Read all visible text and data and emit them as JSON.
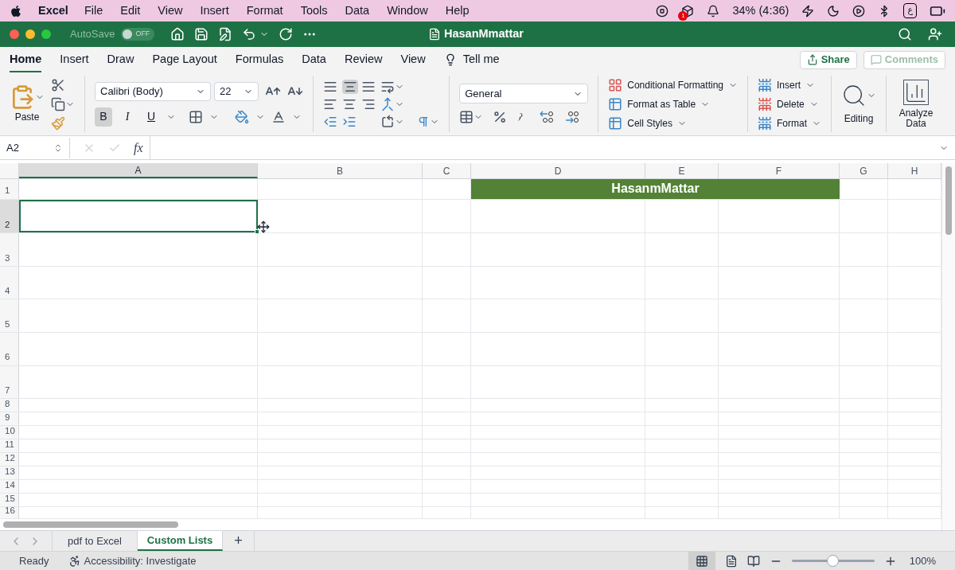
{
  "menubar": {
    "app": "Excel",
    "items": [
      "File",
      "Edit",
      "View",
      "Insert",
      "Format",
      "Tools",
      "Data",
      "Window",
      "Help"
    ],
    "battery": "34% (4:36)",
    "input_source": "ع",
    "notification_badge": "1"
  },
  "title_bar": {
    "autosave_label": "AutoSave",
    "autosave_on": false,
    "autosave_state": "OFF",
    "title": "HasanMmattar"
  },
  "ribbon_tabs": [
    {
      "label": "Home",
      "selected": true
    },
    {
      "label": "Insert",
      "selected": false
    },
    {
      "label": "Draw",
      "selected": false
    },
    {
      "label": "Page Layout",
      "selected": false
    },
    {
      "label": "Formulas",
      "selected": false
    },
    {
      "label": "Data",
      "selected": false
    },
    {
      "label": "Review",
      "selected": false
    },
    {
      "label": "View",
      "selected": false
    }
  ],
  "tell_me": "Tell me",
  "share": {
    "label": "Share",
    "disabled": false
  },
  "comments": {
    "label": "Comments",
    "disabled": true
  },
  "ribbon": {
    "paste": "Paste",
    "font_name": "Calibri (Body)",
    "font_size": "22",
    "format_buttons": [
      {
        "label": "B",
        "selected": true
      },
      {
        "label": "I",
        "selected": false
      },
      {
        "label": "U",
        "selected": false
      }
    ],
    "align_middle_selected": true,
    "number_format": "General",
    "styles": [
      {
        "label": "Conditional Formatting"
      },
      {
        "label": "Format as Table"
      },
      {
        "label": "Cell Styles"
      }
    ],
    "cells": [
      {
        "label": "Insert"
      },
      {
        "label": "Delete"
      },
      {
        "label": "Format"
      }
    ],
    "editing": "Editing",
    "analyze": "Analyze Data"
  },
  "formula_bar": {
    "name_box": "A2",
    "fx": "fx"
  },
  "grid": {
    "columns": [
      {
        "label": "A",
        "selected": true
      },
      {
        "label": "B",
        "selected": false
      },
      {
        "label": "C",
        "selected": false
      },
      {
        "label": "D",
        "selected": false
      },
      {
        "label": "E",
        "selected": false
      },
      {
        "label": "F",
        "selected": false
      },
      {
        "label": "G",
        "selected": false
      },
      {
        "label": "H",
        "selected": false
      }
    ],
    "rows": [
      {
        "label": "1",
        "selected": false
      },
      {
        "label": "2",
        "selected": true
      },
      {
        "label": "3",
        "selected": false
      },
      {
        "label": "4",
        "selected": false
      },
      {
        "label": "5",
        "selected": false
      },
      {
        "label": "6",
        "selected": false
      },
      {
        "label": "7",
        "selected": false
      },
      {
        "label": "8",
        "selected": false
      },
      {
        "label": "9",
        "selected": false
      },
      {
        "label": "10",
        "selected": false
      },
      {
        "label": "11",
        "selected": false
      },
      {
        "label": "12",
        "selected": false
      },
      {
        "label": "13",
        "selected": false
      },
      {
        "label": "14",
        "selected": false
      },
      {
        "label": "15",
        "selected": false
      },
      {
        "label": "16",
        "selected": false
      }
    ],
    "title_cell": "HasanmMattar"
  },
  "sheets": [
    {
      "label": "pdf to Excel",
      "selected": false
    },
    {
      "label": "Custom Lists",
      "selected": true
    }
  ],
  "add_sheet": "+",
  "status_bar": {
    "status": "Ready",
    "accessibility": "Accessibility: Investigate",
    "zoom": {
      "level": 0.5
    },
    "zoom_label": "100%"
  }
}
